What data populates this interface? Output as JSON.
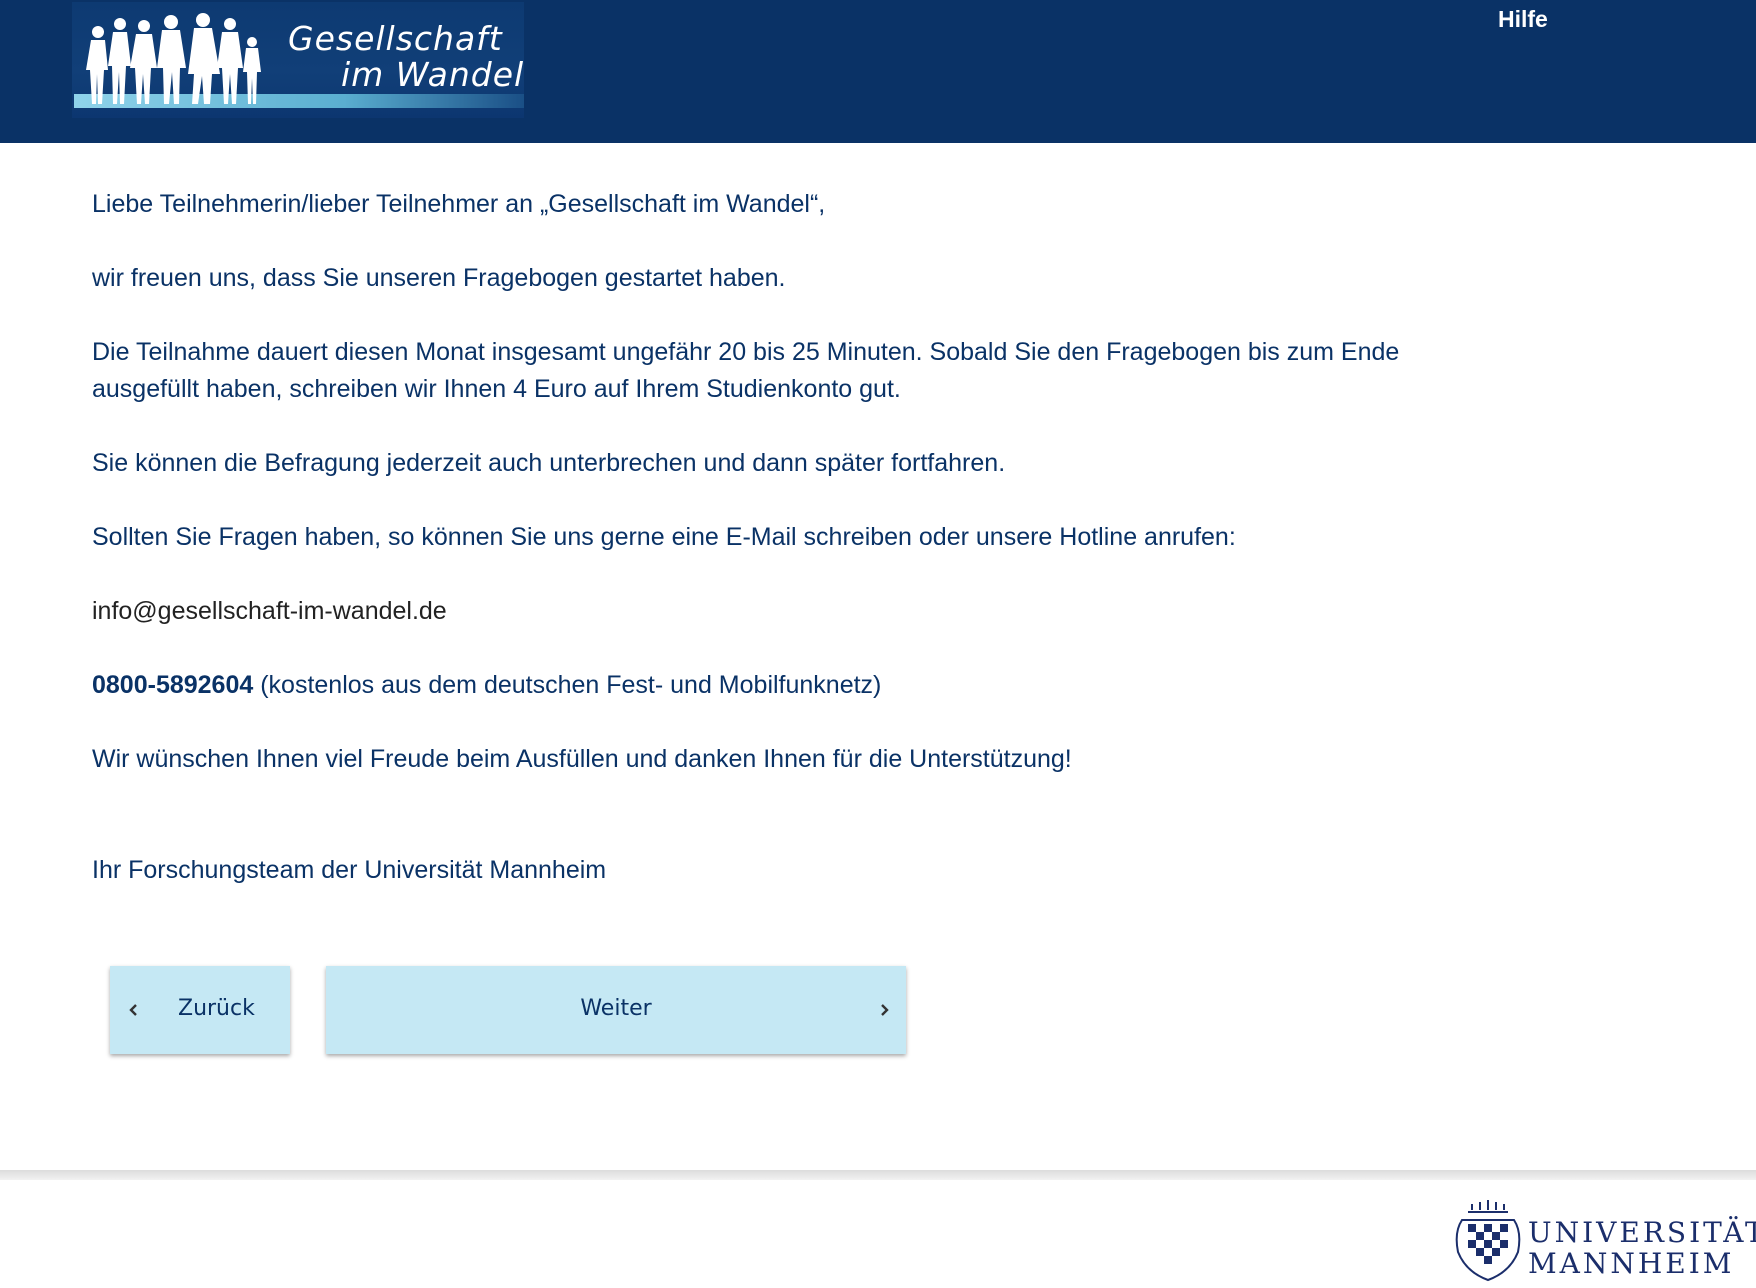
{
  "header": {
    "logo_line1": "Gesellschaft",
    "logo_line2": "im Wandel",
    "help_label": "Hilfe"
  },
  "content": {
    "greeting": "Liebe Teilnehmerin/lieber Teilnehmer an „Gesellschaft im Wandel“,",
    "intro": "wir freuen uns, dass Sie unseren Fragebogen gestartet haben.",
    "duration": "Die Teilnahme dauert diesen Monat insgesamt ungefähr 20 bis 25 Minuten. Sobald Sie den Fragebogen bis zum Ende ausgefüllt haben, schreiben wir Ihnen 4 Euro auf Ihrem Studienkonto gut.",
    "pause": "Sie können die Befragung jederzeit auch unterbrechen und dann später fortfahren.",
    "questions": "Sollten Sie Fragen haben, so können Sie uns gerne eine E-Mail schreiben oder unsere Hotline anrufen:",
    "email": "info@gesellschaft-im-wandel.de",
    "hotline_number": "0800-5892604",
    "hotline_note": " (kostenlos aus dem deutschen Fest- und Mobilfunknetz)",
    "wishes": "Wir wünschen Ihnen viel Freude beim Ausfüllen und danken Ihnen für die Unterstützung!",
    "signature": "Ihr Forschungsteam der Universität Mannheim"
  },
  "nav": {
    "back_label": "Zurück",
    "next_label": "Weiter"
  },
  "footer": {
    "uni_line1": "UNIVERSITÄT",
    "uni_line2": "MANNHEIM"
  },
  "colors": {
    "header_bg": "#0a3266",
    "text": "#0a3266",
    "button_bg": "#c5e8f4"
  }
}
